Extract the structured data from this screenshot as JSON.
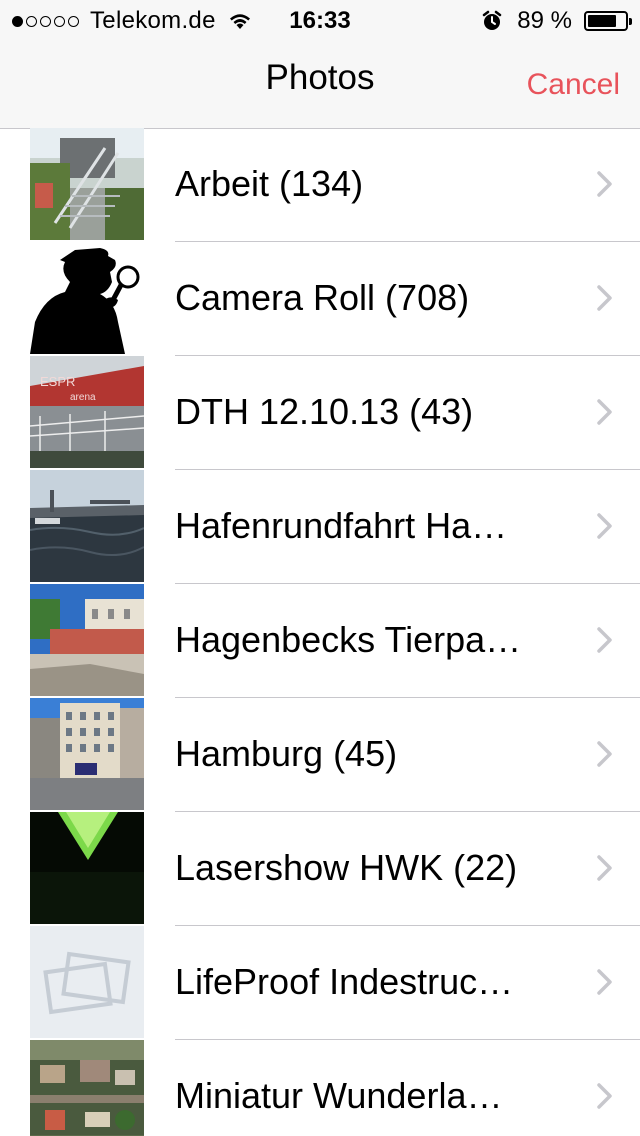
{
  "status_bar": {
    "carrier": "Telekom.de",
    "signal_filled": 1,
    "signal_total": 5,
    "time": "16:33",
    "battery_percent": "89 %",
    "battery_level": 0.89,
    "icons": [
      "wifi-icon",
      "alarm-icon",
      "battery-icon"
    ]
  },
  "nav": {
    "title": "Photos",
    "cancel_label": "Cancel",
    "accent_color": "#e8535b"
  },
  "albums": [
    {
      "label": "Arbeit (134)",
      "thumb": "stairs-garden"
    },
    {
      "label": "Camera Roll (708)",
      "thumb": "detective-silhouette"
    },
    {
      "label": "DTH 12.10.13 (43)",
      "thumb": "arena-facade"
    },
    {
      "label": "Hafenrundfahrt Ha…",
      "thumb": "harbor-water"
    },
    {
      "label": "Hagenbecks Tierpa…",
      "thumb": "zoo-building"
    },
    {
      "label": "Hamburg  (45)",
      "thumb": "city-building"
    },
    {
      "label": "Lasershow HWK (22)",
      "thumb": "green-laser"
    },
    {
      "label": "LifeProof Indestruc…",
      "thumb": "placeholder-photos-icon"
    },
    {
      "label": "Miniatur Wunderla…",
      "thumb": "miniature-landscape"
    }
  ]
}
